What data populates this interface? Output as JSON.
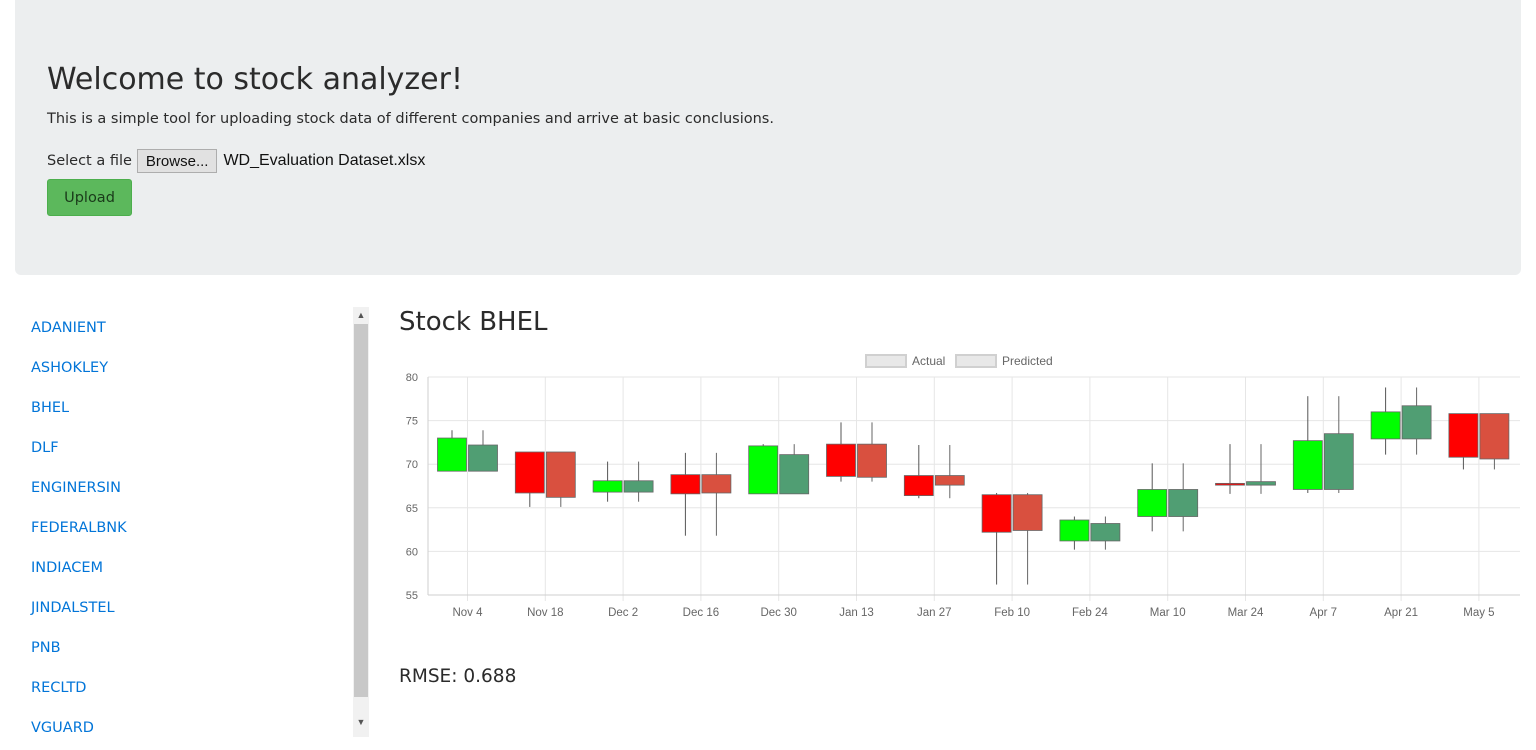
{
  "jumbotron": {
    "title": "Welcome to stock analyzer!",
    "lead": "This is a simple tool for uploading stock data of different companies and arrive at basic conclusions.",
    "file_label": "Select a file",
    "browse_label": "Browse...",
    "file_name": "WD_Evaluation Dataset.xlsx",
    "upload_label": "Upload"
  },
  "sidebar": {
    "items": [
      "ADANIENT",
      "ASHOKLEY",
      "BHEL",
      "DLF",
      "ENGINERSIN",
      "FEDERALBNK",
      "INDIACEM",
      "JINDALSTEL",
      "PNB",
      "RECLTD",
      "VGUARD"
    ]
  },
  "chart": {
    "heading": "Stock BHEL",
    "rmse_label": "RMSE:",
    "rmse_value": "0.688"
  },
  "colors": {
    "actual_up": "#00ff00",
    "actual_down": "#ff0000",
    "predicted_up": "#509e73",
    "predicted_down": "#d9503f",
    "link": "#0275d8",
    "upload_button": "#5cb85c"
  },
  "chart_data": {
    "type": "candlestick",
    "legend": [
      "Actual",
      "Predicted"
    ],
    "legend_position": "top",
    "grid": true,
    "ylim": [
      55,
      80
    ],
    "yticks": [
      55,
      60,
      65,
      70,
      75,
      80
    ],
    "categories": [
      "Nov 4",
      "Nov 18",
      "Dec 2",
      "Dec 16",
      "Dec 30",
      "Jan 13",
      "Jan 27",
      "Feb 10",
      "Feb 24",
      "Mar 10",
      "Mar 24",
      "Apr 7",
      "Apr 21",
      "May 5"
    ],
    "series": [
      {
        "name": "Actual",
        "ohlc": [
          {
            "o": 69.2,
            "h": 73.9,
            "l": 69.2,
            "c": 73.0
          },
          {
            "o": 71.4,
            "h": 71.4,
            "l": 65.1,
            "c": 66.7
          },
          {
            "o": 66.8,
            "h": 70.3,
            "l": 65.7,
            "c": 68.1
          },
          {
            "o": 68.8,
            "h": 71.3,
            "l": 61.8,
            "c": 66.6
          },
          {
            "o": 66.6,
            "h": 72.3,
            "l": 66.6,
            "c": 72.1
          },
          {
            "o": 72.3,
            "h": 74.8,
            "l": 68.0,
            "c": 68.6
          },
          {
            "o": 68.7,
            "h": 72.2,
            "l": 66.1,
            "c": 66.4
          },
          {
            "o": 66.5,
            "h": 66.7,
            "l": 56.2,
            "c": 62.2
          },
          {
            "o": 61.2,
            "h": 64.0,
            "l": 60.2,
            "c": 63.6
          },
          {
            "o": 64.0,
            "h": 70.1,
            "l": 62.3,
            "c": 67.1
          },
          {
            "o": 67.8,
            "h": 72.3,
            "l": 66.6,
            "c": 67.6
          },
          {
            "o": 67.1,
            "h": 77.8,
            "l": 66.7,
            "c": 72.7
          },
          {
            "o": 72.9,
            "h": 78.8,
            "l": 71.1,
            "c": 76.0
          },
          {
            "o": 75.8,
            "h": 75.8,
            "l": 69.4,
            "c": 70.8
          }
        ]
      },
      {
        "name": "Predicted",
        "ohlc": [
          {
            "o": 69.2,
            "h": 73.9,
            "l": 69.2,
            "c": 72.2
          },
          {
            "o": 71.4,
            "h": 71.4,
            "l": 65.1,
            "c": 66.2
          },
          {
            "o": 66.8,
            "h": 70.3,
            "l": 65.7,
            "c": 68.1
          },
          {
            "o": 68.8,
            "h": 71.3,
            "l": 61.8,
            "c": 66.7
          },
          {
            "o": 66.6,
            "h": 72.3,
            "l": 66.6,
            "c": 71.1
          },
          {
            "o": 72.3,
            "h": 74.8,
            "l": 68.0,
            "c": 68.5
          },
          {
            "o": 68.7,
            "h": 72.2,
            "l": 66.1,
            "c": 67.6
          },
          {
            "o": 66.5,
            "h": 66.7,
            "l": 56.2,
            "c": 62.4
          },
          {
            "o": 61.2,
            "h": 64.0,
            "l": 60.2,
            "c": 63.2
          },
          {
            "o": 64.0,
            "h": 70.1,
            "l": 62.3,
            "c": 67.1
          },
          {
            "o": 67.6,
            "h": 72.3,
            "l": 66.6,
            "c": 68.0
          },
          {
            "o": 67.1,
            "h": 77.8,
            "l": 66.7,
            "c": 73.5
          },
          {
            "o": 72.9,
            "h": 78.8,
            "l": 71.1,
            "c": 76.7
          },
          {
            "o": 75.8,
            "h": 75.8,
            "l": 69.4,
            "c": 70.6
          }
        ]
      }
    ]
  }
}
